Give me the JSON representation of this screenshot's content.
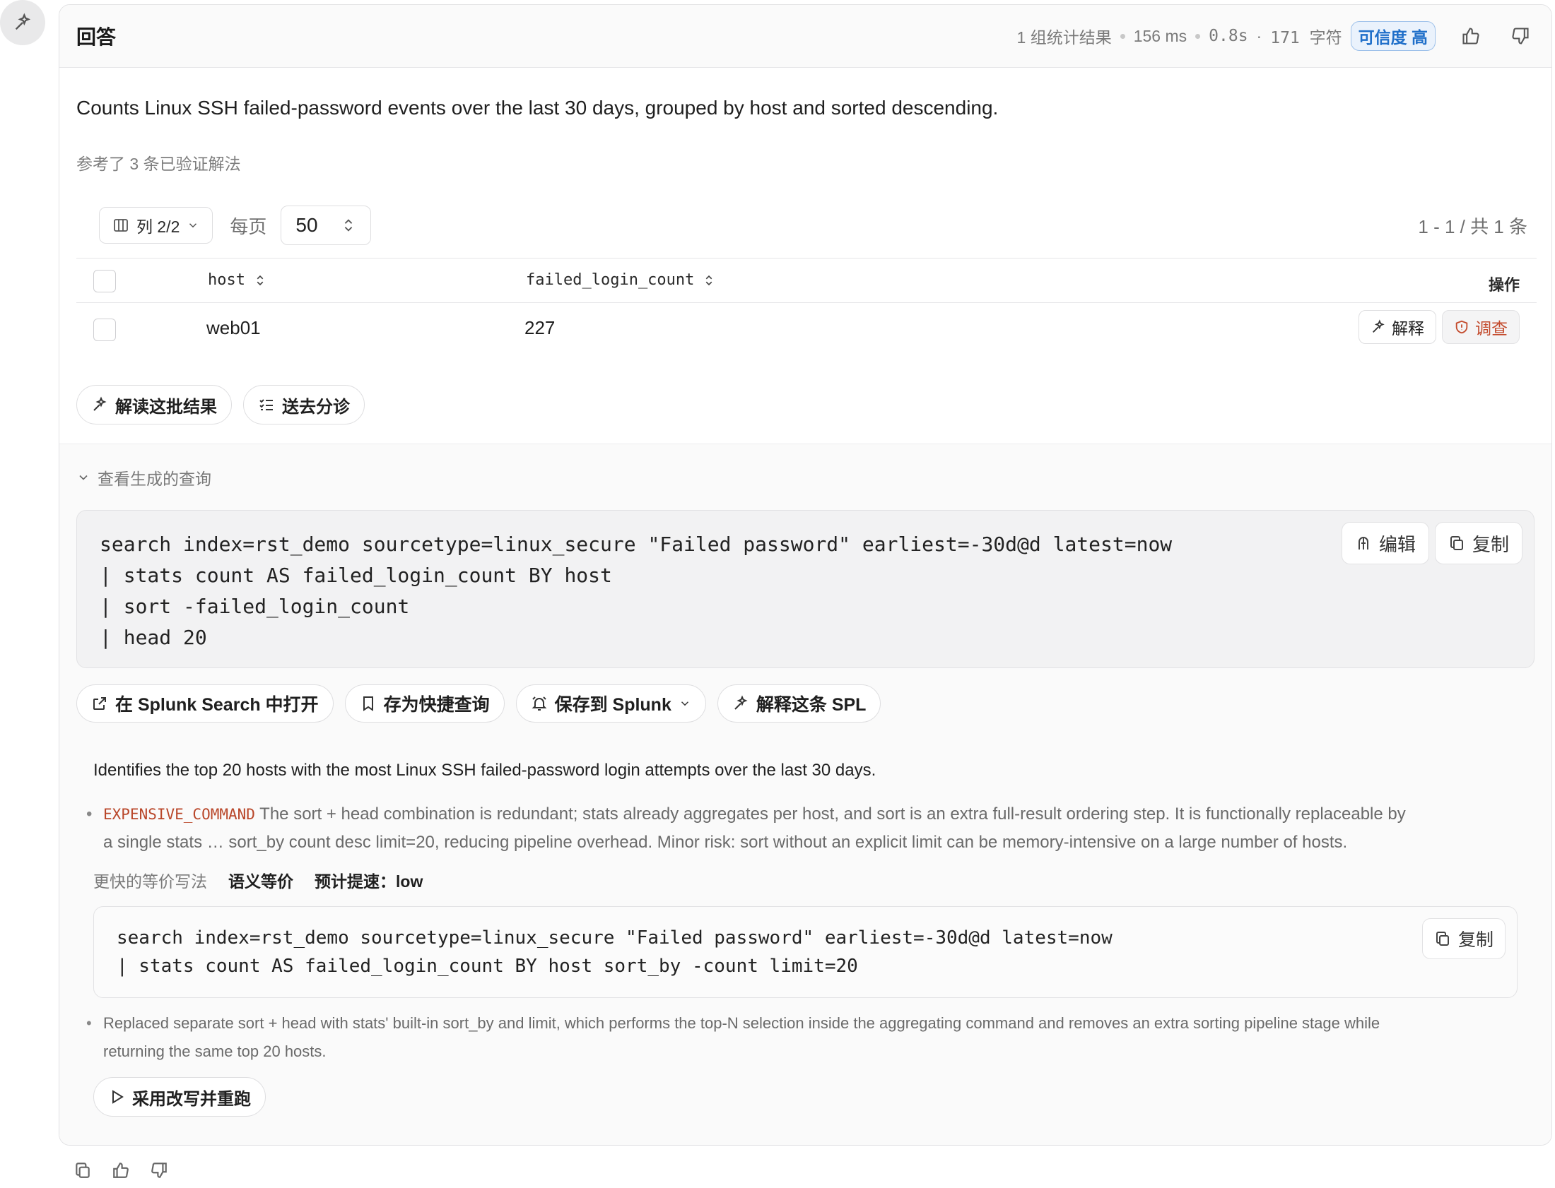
{
  "header": {
    "title": "回答",
    "stat_results": "1 组统计结果",
    "latency": "156 ms",
    "duration": "0.8s",
    "chars": "171 字符",
    "confidence": "可信度 高"
  },
  "summary": "Counts Linux SSH failed-password events over the last 30 days, grouped by host and sorted descending.",
  "refs": "参考了 3 条已验证解法",
  "toolbar": {
    "columns_label": "列 2/2",
    "per_page_label": "每页",
    "per_page_value": "50",
    "pager": "1 - 1 / 共 1 条"
  },
  "table": {
    "columns": [
      "host",
      "failed_login_count"
    ],
    "ops_label": "操作",
    "rows": [
      {
        "host": "web01",
        "failed_login_count": "227"
      }
    ],
    "explain_label": "解释",
    "investigate_label": "调查"
  },
  "batch_actions": {
    "interpret": "解读这批结果",
    "triage": "送去分诊"
  },
  "query": {
    "toggle_label": "查看生成的查询",
    "lines": [
      "search index=rst_demo sourcetype=linux_secure \"Failed password\" earliest=-30d@d latest=now",
      "| stats count AS failed_login_count BY host",
      "| sort -failed_login_count",
      "| head 20"
    ],
    "edit_label": "编辑",
    "copy_label": "复制"
  },
  "query_actions": {
    "open_splunk": "在 Splunk Search 中打开",
    "save_shortcut": "存为快捷查询",
    "save_splunk": "保存到 Splunk",
    "explain_spl": "解释这条 SPL"
  },
  "explanation": {
    "title": "Identifies the top 20 hosts with the most Linux SSH failed-password login attempts over the last 30 days.",
    "tag": "EXPENSIVE_COMMAND",
    "note_line1": "The sort + head combination is redundant; stats already aggregates per host, and sort is an extra full-result ordering step. It is functionally replaceable by",
    "note_line2": "a single stats … sort_by count desc limit=20, reducing pipeline overhead. Minor risk: sort without an explicit limit can be memory-intensive on a large number of hosts.",
    "faster_label": "更快的等价写法",
    "semantic": "语义等价",
    "speedup": "预计提速：low",
    "rewrite_lines": [
      "search index=rst_demo sourcetype=linux_secure \"Failed password\" earliest=-30d@d latest=now",
      "| stats count AS failed_login_count BY host sort_by -count limit=20"
    ],
    "copy_label": "复制",
    "rewrite_note_line1": "Replaced separate sort + head with stats' built-in sort_by and limit, which performs the top-N selection inside the aggregating command and removes an extra sorting pipeline stage while",
    "rewrite_note_line2": "returning the same top 20 hosts.",
    "rerun_label": "采用改写并重跑"
  },
  "colors": {
    "accent": "#1f6fc9",
    "danger": "#c34a2c",
    "tag": "#b9472a"
  }
}
